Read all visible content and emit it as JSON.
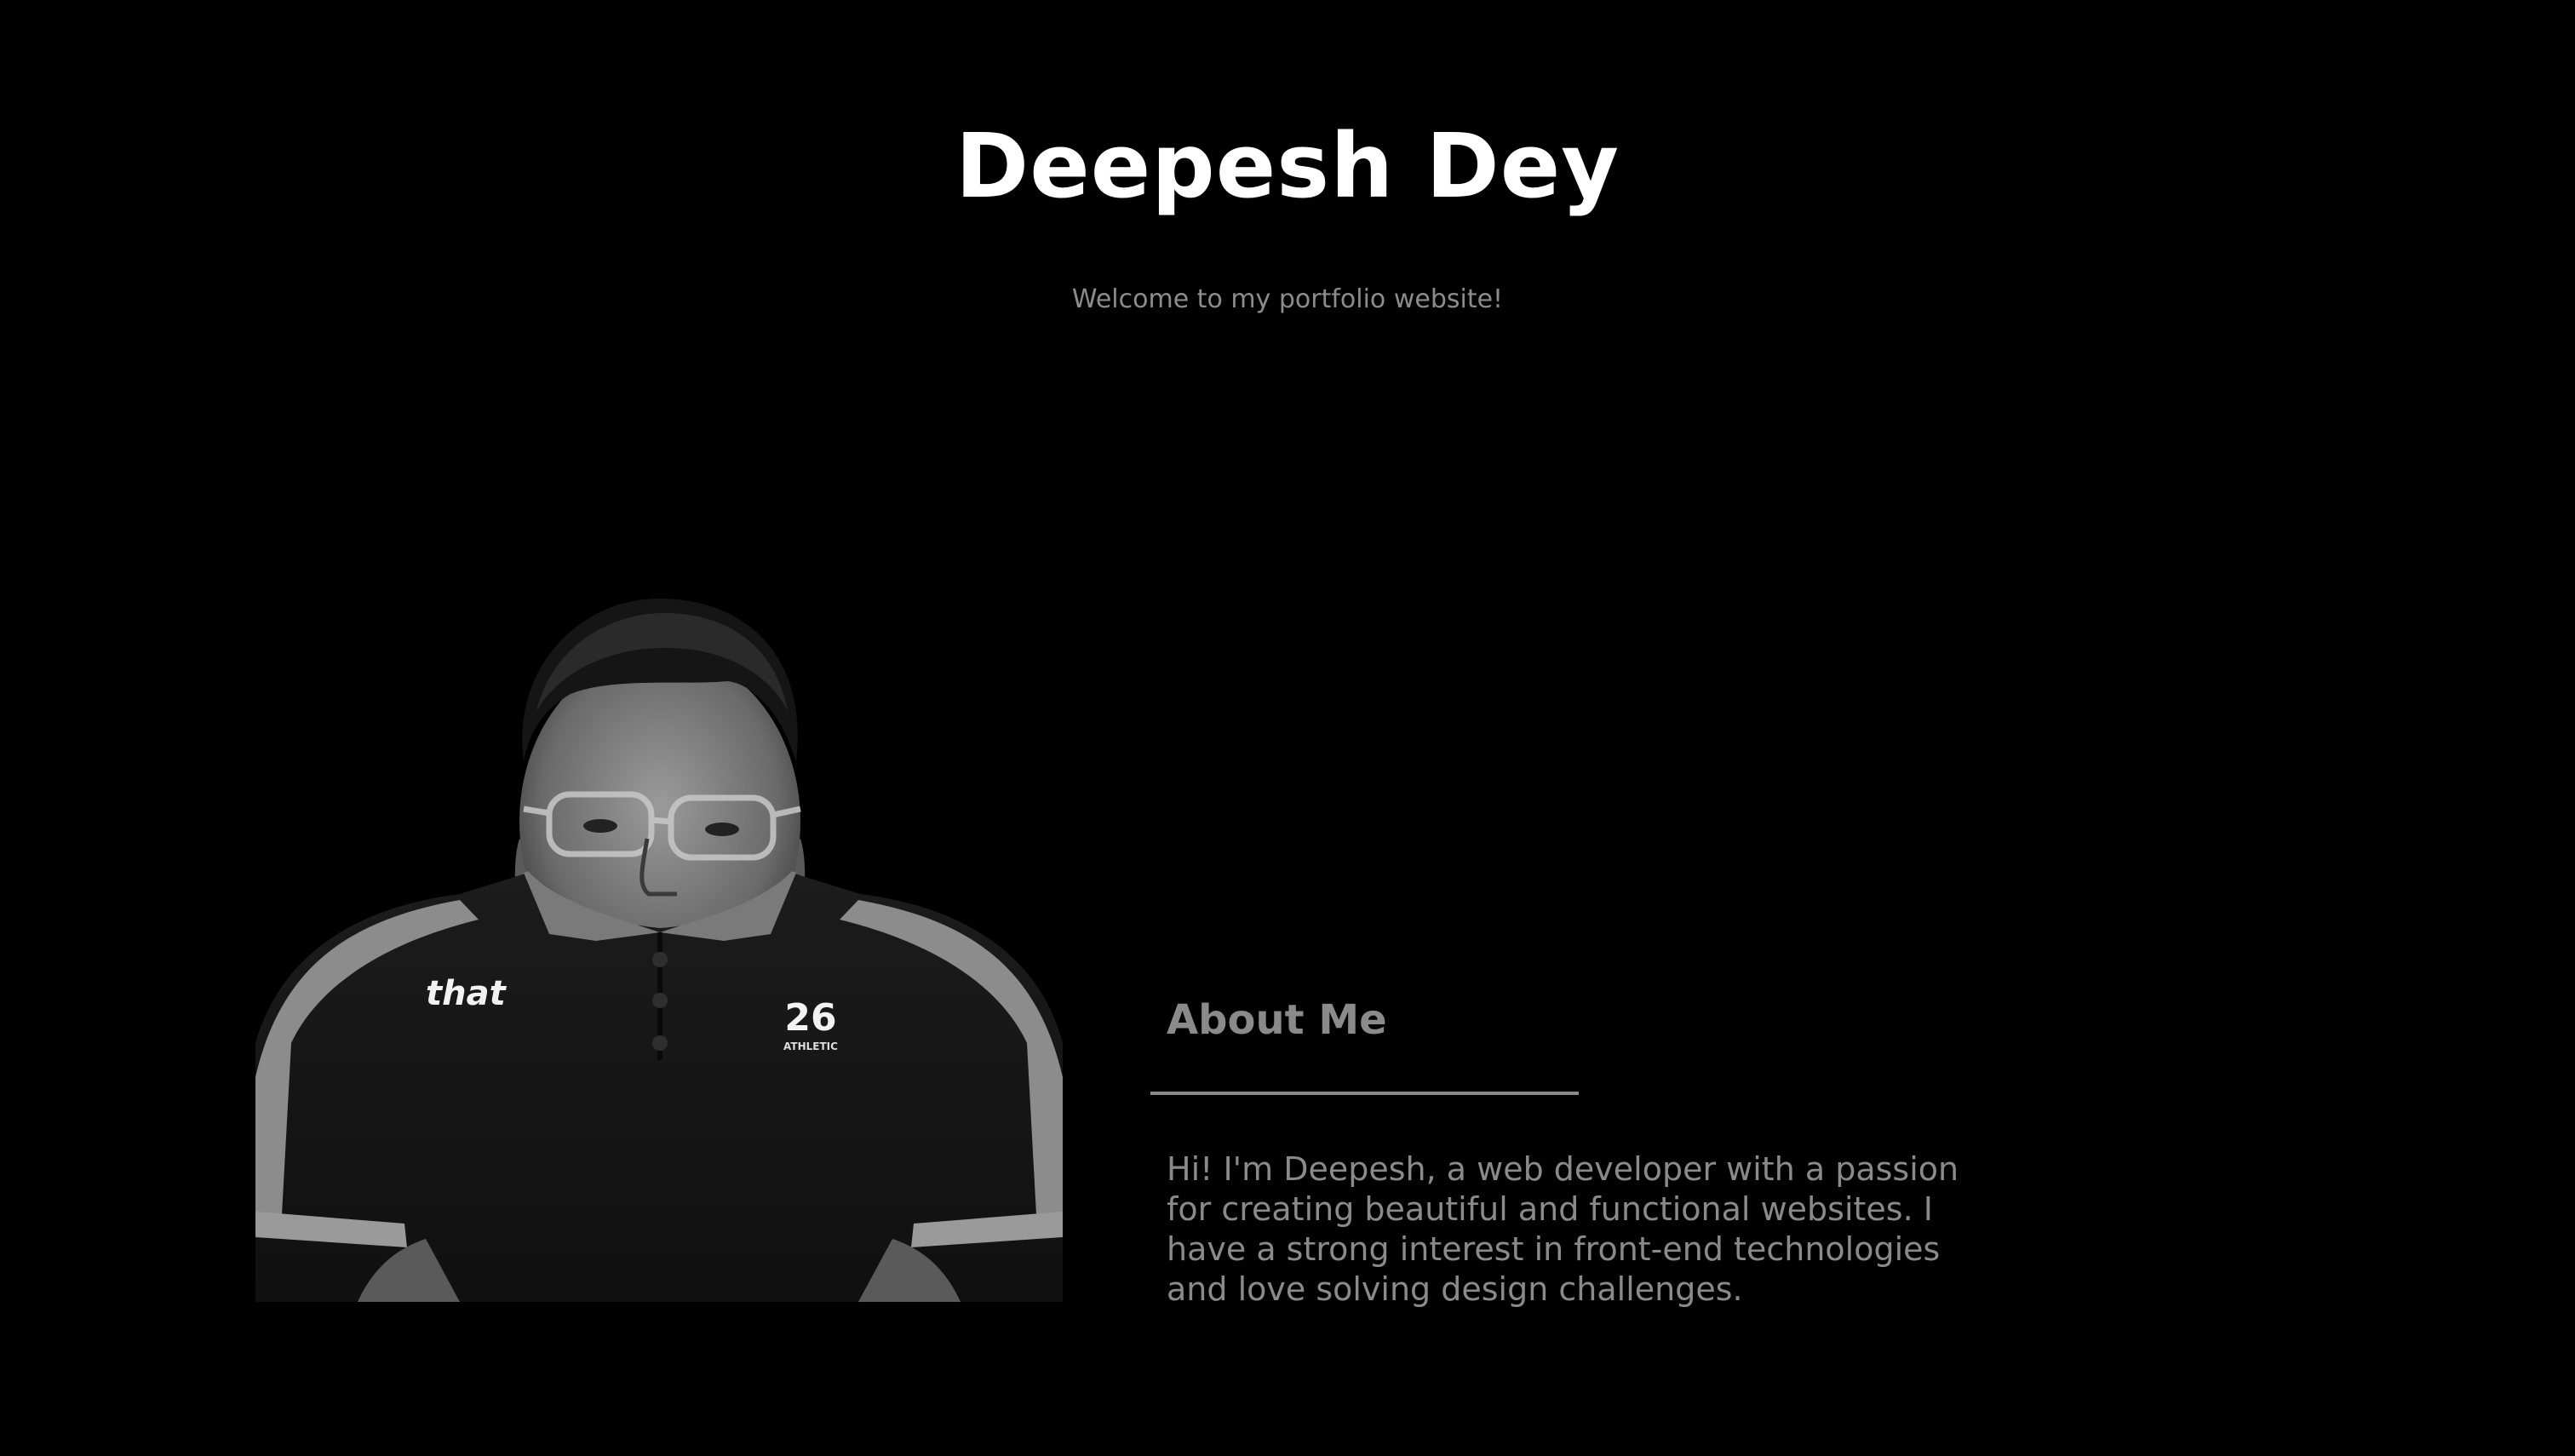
{
  "header": {
    "title": "Deepesh Dey",
    "subtitle": "Welcome to my portfolio website!"
  },
  "about": {
    "heading": "About Me",
    "text": "Hi! I'm Deepesh, a web developer with a passion for creating beautiful and functional websites. I have a strong interest in front-end technologies and love solving design challenges."
  },
  "portrait": {
    "shirt_logo_text": "that",
    "shirt_number": "26",
    "shirt_badge_text": "ATHLETIC"
  },
  "colors": {
    "background": "#000000",
    "title": "#ffffff",
    "muted_text": "#8a8a8a"
  }
}
